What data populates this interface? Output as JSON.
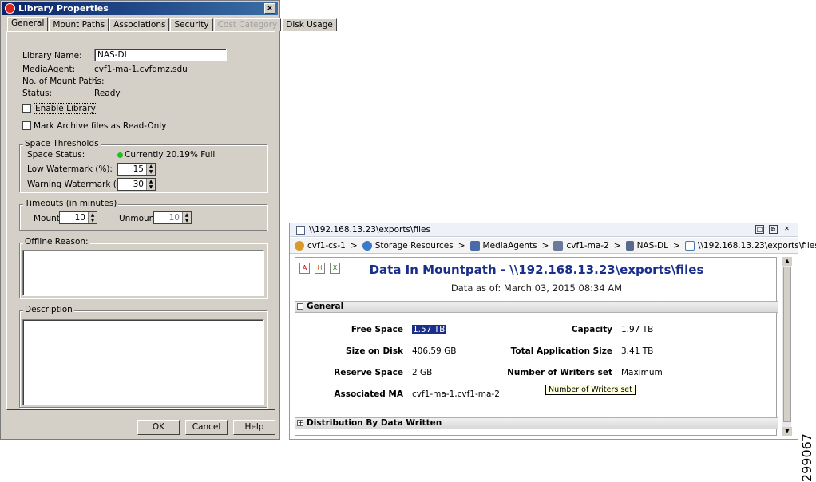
{
  "dialog": {
    "title": "Library Properties",
    "tabs": [
      {
        "label": "General",
        "active": true,
        "disabled": false
      },
      {
        "label": "Mount Paths",
        "active": false,
        "disabled": false
      },
      {
        "label": "Associations",
        "active": false,
        "disabled": false
      },
      {
        "label": "Security",
        "active": false,
        "disabled": false
      },
      {
        "label": "Cost Category",
        "active": false,
        "disabled": true
      },
      {
        "label": "Disk Usage",
        "active": false,
        "disabled": false
      }
    ],
    "fields": {
      "library_name_label": "Library Name:",
      "library_name_value": "NAS-DL",
      "media_agent_label": "MediaAgent:",
      "media_agent_value": "cvf1-ma-1.cvfdmz.sdu",
      "mount_paths_label": "No. of Mount Paths:",
      "mount_paths_value": "1",
      "status_label": "Status:",
      "status_value": "Ready"
    },
    "enable_library_label": "Enable Library",
    "mark_archive_label": "Mark Archive files as Read-Only",
    "space_thresholds": {
      "group_title": "Space Thresholds",
      "space_status_label": "Space Status:",
      "space_status_value": "Currently 20.19% Full",
      "low_watermark_label": "Low Watermark (%):",
      "low_watermark_value": "15",
      "warning_watermark_label": "Warning Watermark (%):",
      "warning_watermark_value": "30"
    },
    "timeouts": {
      "group_title": "Timeouts (in minutes)",
      "mount_label": "Mount:",
      "mount_value": "10",
      "unmount_label": "Unmount:",
      "unmount_value": "10"
    },
    "offline_reason_label": "Offline Reason:",
    "description_label": "Description",
    "buttons": {
      "ok": "OK",
      "cancel": "Cancel",
      "help": "Help"
    },
    "close_glyph": "×"
  },
  "report": {
    "window_title": "\\\\192.168.13.23\\exports\\files",
    "breadcrumbs": [
      {
        "label": "cvf1-cs-1",
        "icon": "commcell-icon",
        "color": "#d89a2a"
      },
      {
        "label": "Storage Resources",
        "icon": "storage-icon",
        "color": "#3a7ac8"
      },
      {
        "label": "MediaAgents",
        "icon": "mediaagents-icon",
        "color": "#4a6aa8"
      },
      {
        "label": "cvf1-ma-2",
        "icon": "mediaagent-icon",
        "color": "#6a7a9a"
      },
      {
        "label": "NAS-DL",
        "icon": "library-icon",
        "color": "#5a6a8a"
      },
      {
        "label": "\\\\192.168.13.23\\exports\\files",
        "icon": "mountpath-icon",
        "color": "#4a7ab0"
      }
    ],
    "title": "Data In Mountpath - \\\\192.168.13.23\\exports\\files",
    "subtitle": "Data as of: March 03, 2015 08:34 AM",
    "general_section": "General",
    "general_toggle": "−",
    "fields": {
      "free_space_label": "Free Space",
      "free_space_value": "1.57 TB",
      "capacity_label": "Capacity",
      "capacity_value": "1.97 TB",
      "size_on_disk_label": "Size on Disk",
      "size_on_disk_value": "406.59 GB",
      "total_app_size_label": "Total Application Size",
      "total_app_size_value": "3.41 TB",
      "reserve_space_label": "Reserve Space",
      "reserve_space_value": "2 GB",
      "writers_label": "Number of Writers set",
      "writers_value": "Maximum",
      "associated_ma_label": "Associated MA",
      "associated_ma_value": "cvf1-ma-1,cvf1-ma-2"
    },
    "tooltip": "Number of Writers set",
    "distribution_section": "Distribution By Data Written",
    "distribution_toggle": "+"
  },
  "figure_id": "299067"
}
